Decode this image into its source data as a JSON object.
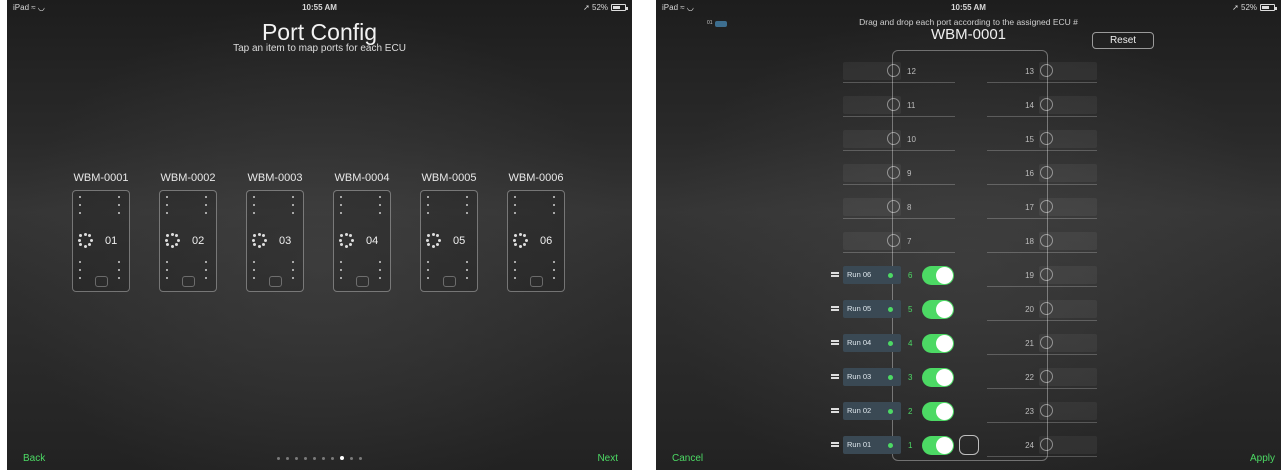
{
  "left": {
    "status": {
      "carrier": "iPad ≈ ◡",
      "time": "10:55 AM",
      "battery": "➚ 52%"
    },
    "title": "Port Config",
    "subtitle": "Tap an item to map ports for each ECU",
    "ecus": [
      {
        "label": "WBM-0001",
        "num": "01"
      },
      {
        "label": "WBM-0002",
        "num": "02"
      },
      {
        "label": "WBM-0003",
        "num": "03"
      },
      {
        "label": "WBM-0004",
        "num": "04"
      },
      {
        "label": "WBM-0005",
        "num": "05"
      },
      {
        "label": "WBM-0006",
        "num": "06"
      }
    ],
    "back": "Back",
    "next": "Next",
    "page_dots": {
      "count": 10,
      "active_index": 7
    }
  },
  "right": {
    "status": {
      "carrier": "iPad ≈ ◡",
      "time": "10:55 AM",
      "battery": "➚ 52%"
    },
    "tiny_tag": "01",
    "instruction": "Drag and drop each port according to the assigned ECU #",
    "title": "WBM-0001",
    "reset": "Reset",
    "cancel": "Cancel",
    "apply": "Apply",
    "empty_left_ports": [
      "12",
      "11",
      "10",
      "9",
      "8",
      "7"
    ],
    "right_ports": [
      "13",
      "14",
      "15",
      "16",
      "17",
      "18",
      "19",
      "20",
      "21",
      "22",
      "23",
      "24"
    ],
    "runs": [
      {
        "label": "Run 06",
        "port": "6",
        "enabled": true
      },
      {
        "label": "Run 05",
        "port": "5",
        "enabled": true
      },
      {
        "label": "Run 04",
        "port": "4",
        "enabled": true
      },
      {
        "label": "Run 03",
        "port": "3",
        "enabled": true
      },
      {
        "label": "Run 02",
        "port": "2",
        "enabled": true
      },
      {
        "label": "Run 01",
        "port": "1",
        "enabled": true
      }
    ]
  },
  "colors": {
    "accent": "#4cd964",
    "chip": "#3a4954",
    "background": "#2a2a2a"
  }
}
